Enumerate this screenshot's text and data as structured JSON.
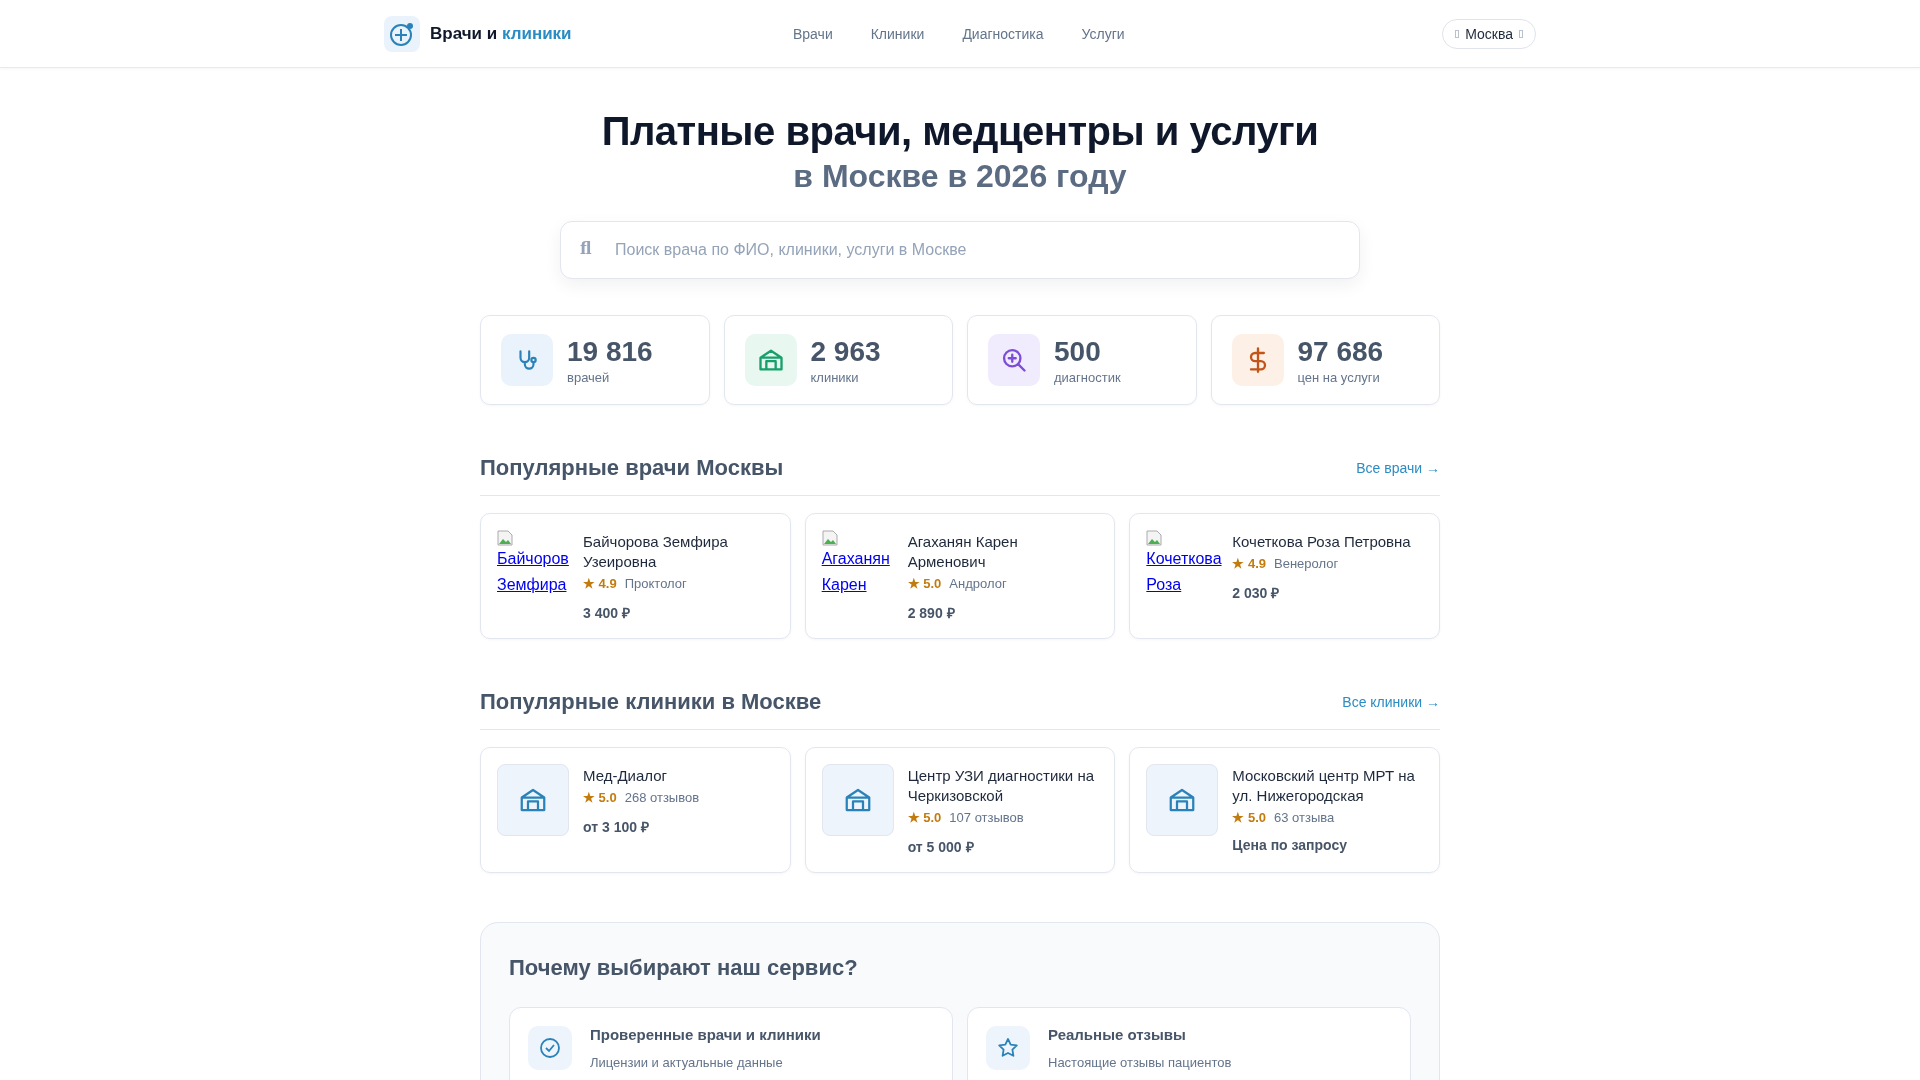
{
  "header": {
    "logo_text": "Врачи и",
    "logo_accent": "клиники",
    "nav": [
      {
        "label": "Врачи"
      },
      {
        "label": "Клиники"
      },
      {
        "label": "Диагностика"
      },
      {
        "label": "Услуги"
      }
    ],
    "city": "Москва"
  },
  "hero": {
    "title": "Платные врачи, медцентры и услуги",
    "subtitle": "в Москве в 2026 году"
  },
  "search": {
    "icon_glyph": "ﬂ",
    "placeholder": "Поиск врача по ФИО, клиники, услуги в Москве"
  },
  "stats": [
    {
      "kind": "doctors",
      "value": "19 816",
      "label": "врачей"
    },
    {
      "kind": "clinics",
      "value": "2 963",
      "label": "клиники"
    },
    {
      "kind": "diagnostics",
      "value": "500",
      "label": "диагностик"
    },
    {
      "kind": "prices",
      "value": "97 686",
      "label": "цен на услуги"
    }
  ],
  "doctors_section": {
    "title": "Популярные врачи Москвы",
    "link": "Все врачи →",
    "items": [
      {
        "photo_alt": [
          "Байчоров",
          "Земфира"
        ],
        "name": "Байчорова Земфира Узеировна",
        "rating": "★ 4.9",
        "specialty": "Проктолог",
        "price": "3 400 ₽"
      },
      {
        "photo_alt": [
          "Агаханян",
          "Карен"
        ],
        "name": "Агаханян Карен Арменович",
        "rating": "★ 5.0",
        "specialty": "Андролог",
        "price": "2 890 ₽"
      },
      {
        "photo_alt": [
          "Кочеткова",
          "Роза"
        ],
        "name": "Кочеткова Роза Петровна",
        "rating": "★ 4.9",
        "specialty": "Венеролог",
        "price": "2 030 ₽"
      }
    ]
  },
  "clinics_section": {
    "title": "Популярные клиники в Москве",
    "link": "Все клиники →",
    "items": [
      {
        "name": "Мед-Диалог",
        "rating": "★ 5.0",
        "reviews": "268 отзывов",
        "price": "от 3 100 ₽"
      },
      {
        "name": "Центр УЗИ диагностики на Черкизовской",
        "rating": "★ 5.0",
        "reviews": "107 отзывов",
        "price": "от 5 000 ₽"
      },
      {
        "name": "Московский центр МРТ на ул. Нижегородская",
        "rating": "★ 5.0",
        "reviews": "63 отзыва",
        "price": "Цена по запросу"
      }
    ]
  },
  "why_section": {
    "title": "Почему выбирают наш сервис?",
    "items": [
      {
        "kind": "verified",
        "title": "Проверенные врачи и клиники",
        "text": "Лицензии и актуальные данные"
      },
      {
        "kind": "reviews",
        "title": "Реальные отзывы",
        "text": "Настоящие отзывы пациентов"
      }
    ]
  }
}
